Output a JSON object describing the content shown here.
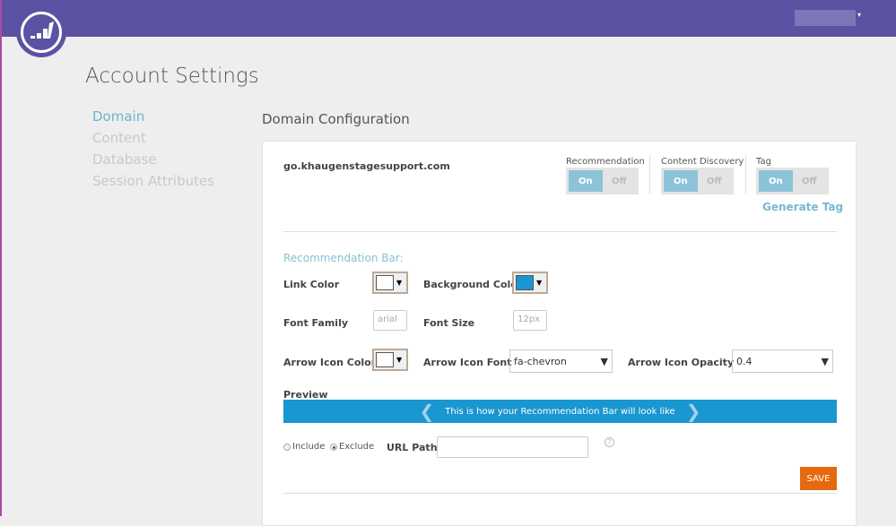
{
  "header": {
    "user_menu_caret": "▾"
  },
  "page_title": "Account Settings",
  "nav": [
    "Domain",
    "Content",
    "Database",
    "Session Attributes"
  ],
  "section_title": "Domain Configuration",
  "domain": "go.khaugenstagesupport.com",
  "toggles": [
    {
      "label": "Recommendation",
      "on": "On",
      "off": "Off",
      "state": "On"
    },
    {
      "label": "Content Discovery",
      "on": "On",
      "off": "Off",
      "state": "On"
    },
    {
      "label": "Tag",
      "on": "On",
      "off": "Off",
      "state": "On"
    }
  ],
  "generate_tag": "Generate Tag",
  "rec_bar": {
    "heading": "Recommendation Bar:",
    "link_color_label": "Link Color",
    "link_color": "#ffffff",
    "bg_color_label": "Background Color",
    "bg_color": "#1a96d0",
    "font_family_label": "Font Family",
    "font_family_placeholder": "arial",
    "font_size_label": "Font Size",
    "font_size_placeholder": "12px",
    "arrow_color_label": "Arrow Icon Color",
    "arrow_color": "#ffffff",
    "arrow_font_label": "Arrow Icon Font",
    "arrow_font": "fa-chevron",
    "arrow_opacity_label": "Arrow Icon Opacity",
    "arrow_opacity": "0.4",
    "caret": "▼",
    "preview_label": "Preview",
    "preview_text": "This is how your Recommendation Bar will look like",
    "prev_arrow": "❮",
    "next_arrow": "❯"
  },
  "filter": {
    "include": "Include",
    "exclude": "Exclude",
    "selected": "Exclude",
    "url_label": "URL Path",
    "url_value": "",
    "help": "?"
  },
  "save": "SAVE"
}
